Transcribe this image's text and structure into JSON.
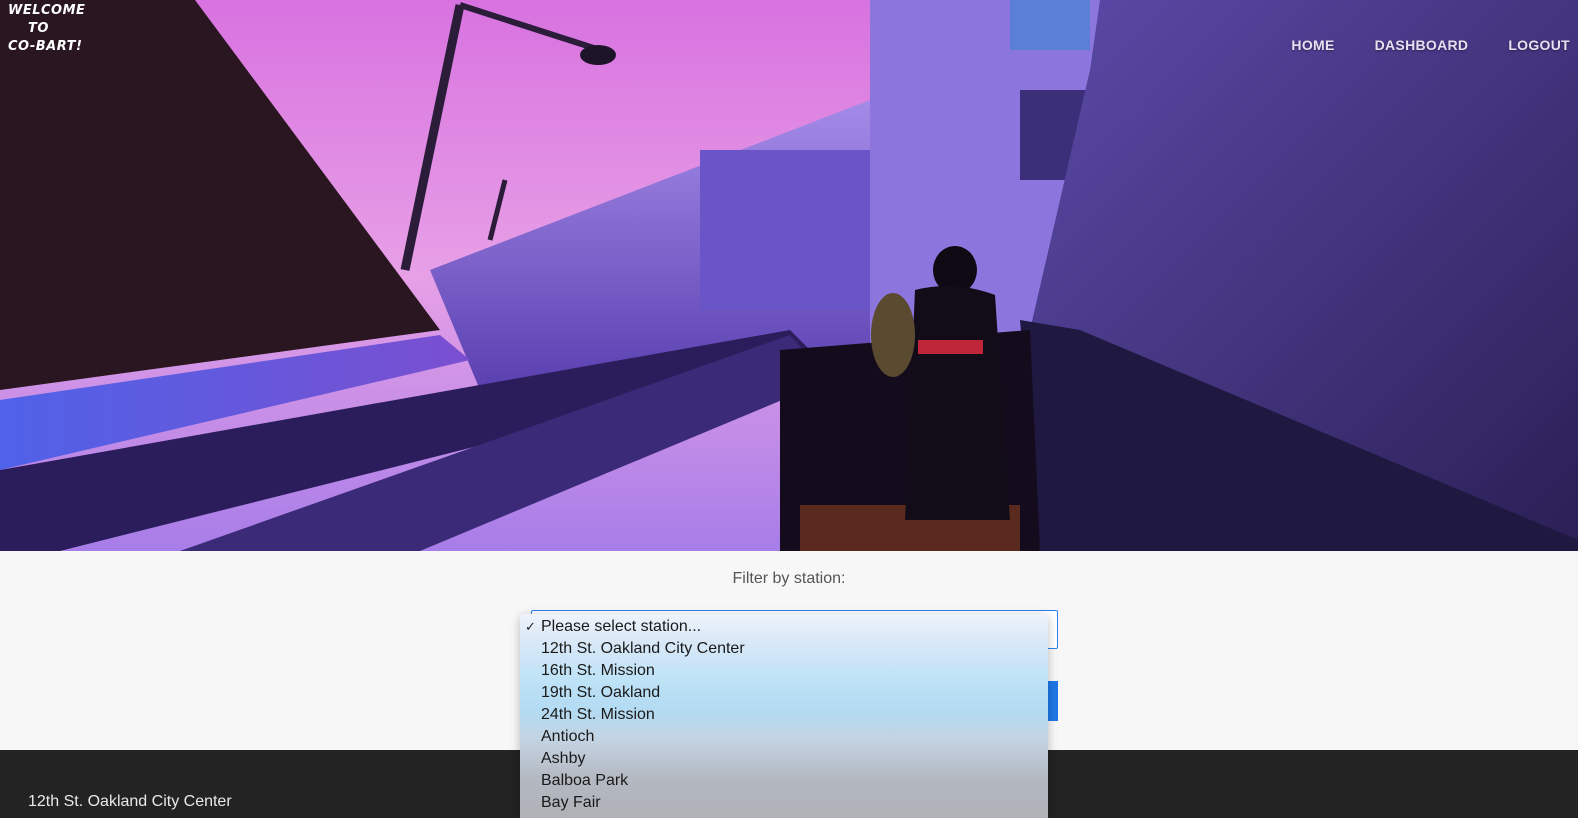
{
  "header": {
    "logo_lines": [
      "WELCOME",
      "TO",
      "CO-BART!"
    ],
    "nav": [
      "HOME",
      "DASHBOARD",
      "LOGOUT"
    ]
  },
  "filter": {
    "label": "Filter by station:",
    "selected": "Please select station...",
    "options": [
      "Please select station...",
      "12th St. Oakland City Center",
      "16th St. Mission",
      "19th St. Oakland",
      "24th St. Mission",
      "Antioch",
      "Ashby",
      "Balboa Park",
      "Bay Fair"
    ]
  },
  "footer": {
    "station_name": "12th St. Oakland City Center"
  },
  "colors": {
    "accent": "#1e78e6",
    "footer_bg": "#232323",
    "select_border": "#2f80ed"
  },
  "icons": {
    "checkmark": "checkmark-icon"
  }
}
